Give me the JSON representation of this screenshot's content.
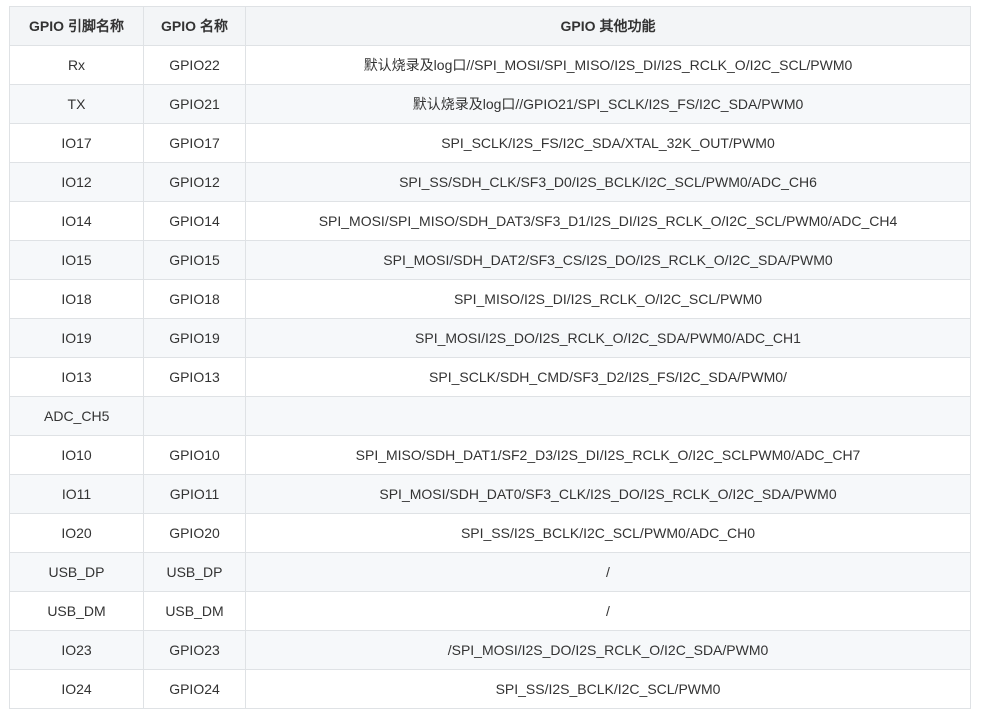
{
  "table": {
    "headers": [
      "GPIO 引脚名称",
      "GPIO 名称",
      "GPIO 其他功能"
    ],
    "rows": [
      {
        "pin": "Rx",
        "gpio": "GPIO22",
        "func": "默认烧录及log口//SPI_MOSI/SPI_MISO/I2S_DI/I2S_RCLK_O/I2C_SCL/PWM0"
      },
      {
        "pin": "TX",
        "gpio": "GPIO21",
        "func": "默认烧录及log口//GPIO21/SPI_SCLK/I2S_FS/I2C_SDA/PWM0"
      },
      {
        "pin": "IO17",
        "gpio": "GPIO17",
        "func": "SPI_SCLK/I2S_FS/I2C_SDA/XTAL_32K_OUT/PWM0"
      },
      {
        "pin": "IO12",
        "gpio": "GPIO12",
        "func": "SPI_SS/SDH_CLK/SF3_D0/I2S_BCLK/I2C_SCL/PWM0/ADC_CH6"
      },
      {
        "pin": "IO14",
        "gpio": "GPIO14",
        "func": "SPI_MOSI/SPI_MISO/SDH_DAT3/SF3_D1/I2S_DI/I2S_RCLK_O/I2C_SCL/PWM0/ADC_CH4"
      },
      {
        "pin": "IO15",
        "gpio": "GPIO15",
        "func": "SPI_MOSI/SDH_DAT2/SF3_CS/I2S_DO/I2S_RCLK_O/I2C_SDA/PWM0"
      },
      {
        "pin": "IO18",
        "gpio": "GPIO18",
        "func": "SPI_MISO/I2S_DI/I2S_RCLK_O/I2C_SCL/PWM0"
      },
      {
        "pin": "IO19",
        "gpio": "GPIO19",
        "func": "SPI_MOSI/I2S_DO/I2S_RCLK_O/I2C_SDA/PWM0/ADC_CH1"
      },
      {
        "pin": "IO13",
        "gpio": "GPIO13",
        "func": "SPI_SCLK/SDH_CMD/SF3_D2/I2S_FS/I2C_SDA/PWM0/"
      },
      {
        "pin": "ADC_CH5",
        "gpio": "",
        "func": "",
        "left": true
      },
      {
        "pin": "IO10",
        "gpio": "GPIO10",
        "func": "SPI_MISO/SDH_DAT1/SF2_D3/I2S_DI/I2S_RCLK_O/I2C_SCLPWM0/ADC_CH7"
      },
      {
        "pin": "IO11",
        "gpio": "GPIO11",
        "func": "SPI_MOSI/SDH_DAT0/SF3_CLK/I2S_DO/I2S_RCLK_O/I2C_SDA/PWM0"
      },
      {
        "pin": "IO20",
        "gpio": "GPIO20",
        "func": "SPI_SS/I2S_BCLK/I2C_SCL/PWM0/ADC_CH0"
      },
      {
        "pin": "USB_DP",
        "gpio": "USB_DP",
        "func": "/"
      },
      {
        "pin": "USB_DM",
        "gpio": "USB_DM",
        "func": "/"
      },
      {
        "pin": "IO23",
        "gpio": "GPIO23",
        "func": "/SPI_MOSI/I2S_DO/I2S_RCLK_O/I2C_SDA/PWM0"
      },
      {
        "pin": "IO24",
        "gpio": "GPIO24",
        "func": "SPI_SS/I2S_BCLK/I2C_SCL/PWM0"
      }
    ]
  }
}
